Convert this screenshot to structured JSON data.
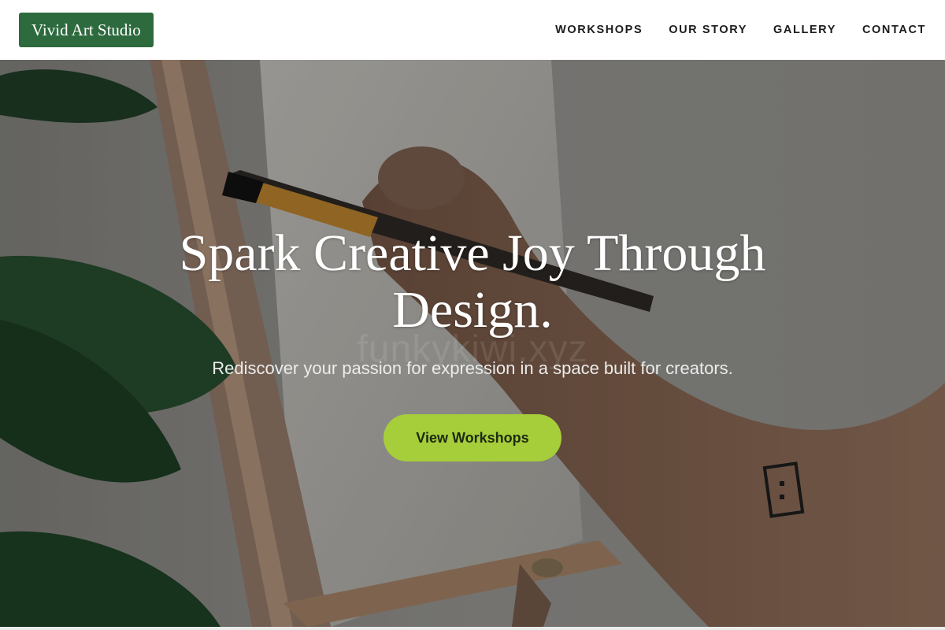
{
  "header": {
    "logo_text": "Vivid Art Studio",
    "nav": [
      {
        "label": "WORKSHOPS"
      },
      {
        "label": "OUR STORY"
      },
      {
        "label": "GALLERY"
      },
      {
        "label": "CONTACT"
      }
    ]
  },
  "hero": {
    "title": "Spark Creative Joy Through Design.",
    "subtitle": "Rediscover your passion for expression in a space built for creators.",
    "watermark": "funkykiwi.xyz",
    "cta_label": "View Workshops"
  },
  "colors": {
    "logo_bg": "#2d6a3e",
    "cta_bg": "#a6cd3a",
    "nav_text": "#1b1b1b"
  }
}
